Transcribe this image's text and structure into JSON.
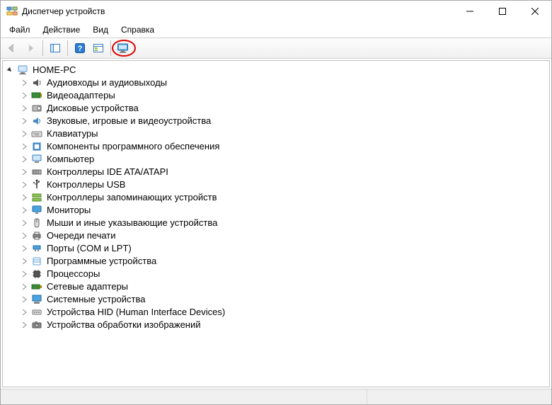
{
  "window": {
    "title": "Диспетчер устройств"
  },
  "menu": {
    "file": "Файл",
    "action": "Действие",
    "view": "Вид",
    "help": "Справка"
  },
  "tree": {
    "root": "HOME-PC",
    "categories": [
      "Аудиовходы и аудиовыходы",
      "Видеоадаптеры",
      "Дисковые устройства",
      "Звуковые, игровые и видеоустройства",
      "Клавиатуры",
      "Компоненты программного обеспечения",
      "Компьютер",
      "Контроллеры IDE ATA/ATAPI",
      "Контроллеры USB",
      "Контроллеры запоминающих устройств",
      "Мониторы",
      "Мыши и иные указывающие устройства",
      "Очереди печати",
      "Порты (COM и LPT)",
      "Программные устройства",
      "Процессоры",
      "Сетевые адаптеры",
      "Системные устройства",
      "Устройства HID (Human Interface Devices)",
      "Устройства обработки изображений"
    ]
  },
  "icons": {
    "app": "device-manager",
    "back": "arrow-back",
    "forward": "arrow-forward",
    "show_hide": "panel-tree",
    "help": "help",
    "properties": "properties-panel",
    "scan": "monitor-scan"
  }
}
